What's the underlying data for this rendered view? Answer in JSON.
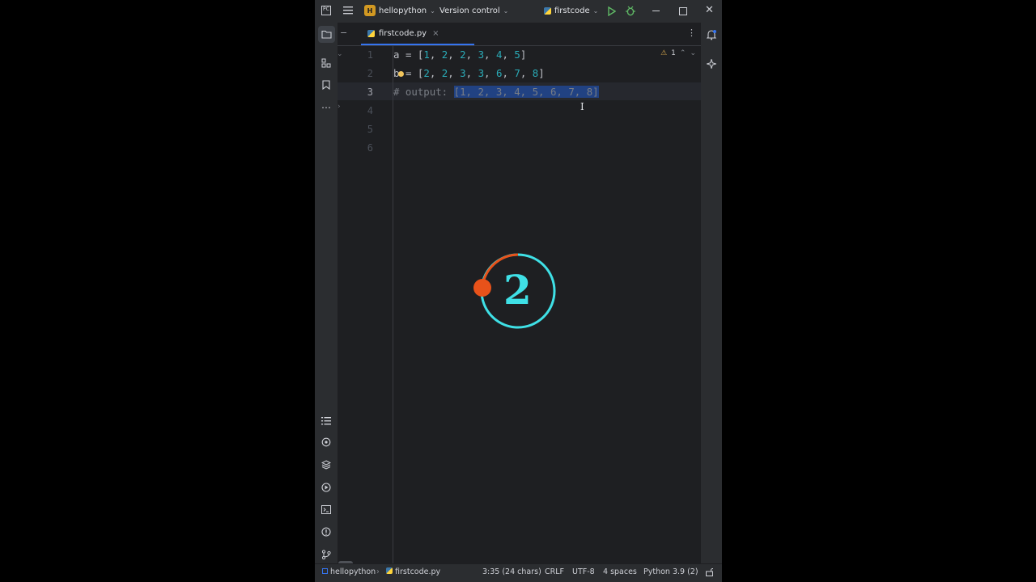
{
  "titlebar": {
    "project_badge": "H",
    "project_name": "hellopython",
    "vcs": "Version control",
    "run_config": "firstcode"
  },
  "tabs": [
    {
      "label": "firstcode.py",
      "close": "×"
    }
  ],
  "editor": {
    "line_numbers": [
      "1",
      "2",
      "3",
      "4",
      "5",
      "6"
    ],
    "current_line": 3,
    "lines": [
      {
        "text": "a = [1, 2, 2, 3, 4, 5]"
      },
      {
        "text": "b = [2, 2, 3, 3, 6, 7, 8]"
      },
      {
        "comment": "# output: ",
        "selected": "[1, 2, 3, 4, 5, 6, 7, 8]"
      }
    ],
    "warnings_count": "1"
  },
  "overlay": {
    "number": "2",
    "ring_color": "#3fe0e6",
    "arc_color": "#e8521a"
  },
  "statusbar": {
    "breadcrumb_project": "hellopython",
    "breadcrumb_file": "firstcode.py",
    "position": "3:35 (24 chars)",
    "line_separator": "CRLF",
    "encoding": "UTF-8",
    "indent": "4 spaces",
    "interpreter": "Python 3.9 (2)"
  },
  "colors": {
    "accent": "#3574f0",
    "number": "#2aacb8",
    "selection": "#214283"
  }
}
